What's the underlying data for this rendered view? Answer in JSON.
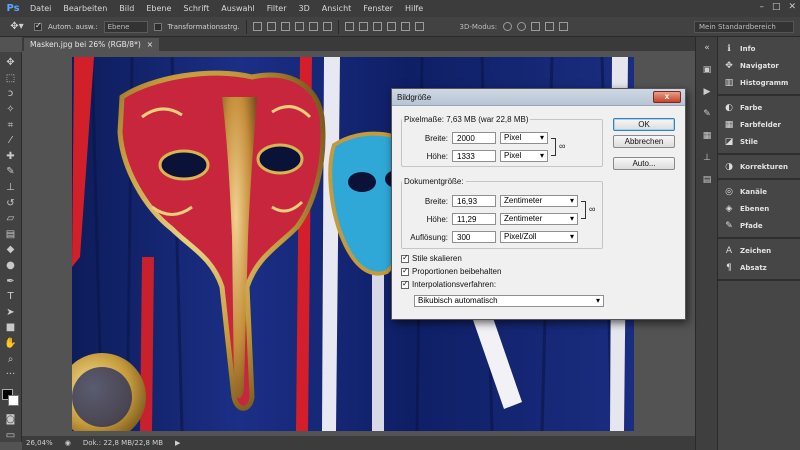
{
  "app": {
    "logo": "Ps"
  },
  "menu": [
    "Datei",
    "Bearbeiten",
    "Bild",
    "Ebene",
    "Schrift",
    "Auswahl",
    "Filter",
    "3D",
    "Ansicht",
    "Fenster",
    "Hilfe"
  ],
  "window_controls": {
    "minimize": "–",
    "maximize": "□",
    "close": "✕"
  },
  "options": {
    "auto_select_label": "Autom. ausw.:",
    "auto_select_value": "Ebene",
    "transform_label": "Transformationsstrg.",
    "mode_3d_label": "3D-Modus:",
    "workspace": "Mein Standardbereich"
  },
  "document_tab": {
    "title": "Masken.jpg bei 26% (RGB/8*)",
    "close": "×"
  },
  "status": {
    "zoom": "26,04%",
    "doc": "Dok.: 22,8 MB/22,8 MB"
  },
  "panels": [
    [
      {
        "icon": "info-icon",
        "glyph": "ℹ",
        "label": "Info"
      },
      {
        "icon": "navigator-icon",
        "glyph": "✥",
        "label": "Navigator"
      },
      {
        "icon": "histogram-icon",
        "glyph": "▥",
        "label": "Histogramm"
      }
    ],
    [
      {
        "icon": "color-icon",
        "glyph": "◐",
        "label": "Farbe"
      },
      {
        "icon": "swatches-icon",
        "glyph": "▦",
        "label": "Farbfelder"
      },
      {
        "icon": "styles-icon",
        "glyph": "◪",
        "label": "Stile"
      }
    ],
    [
      {
        "icon": "adjustments-icon",
        "glyph": "◑",
        "label": "Korrekturen"
      }
    ],
    [
      {
        "icon": "channels-icon",
        "glyph": "◎",
        "label": "Kanäle"
      },
      {
        "icon": "layers-icon",
        "glyph": "◈",
        "label": "Ebenen"
      },
      {
        "icon": "paths-icon",
        "glyph": "✎",
        "label": "Pfade"
      }
    ],
    [
      {
        "icon": "character-icon",
        "glyph": "A",
        "label": "Zeichen"
      },
      {
        "icon": "paragraph-icon",
        "glyph": "¶",
        "label": "Absatz"
      }
    ]
  ],
  "dialog": {
    "title": "Bildgröße",
    "close": "x",
    "pixel_section": {
      "legend": "Pixelmaße: 7,63 MB (war 22,8 MB)",
      "width_label": "Breite:",
      "width_value": "2000",
      "width_unit": "Pixel",
      "height_label": "Höhe:",
      "height_value": "1333",
      "height_unit": "Pixel"
    },
    "doc_section": {
      "legend": "Dokumentgröße:",
      "width_label": "Breite:",
      "width_value": "16,93",
      "width_unit": "Zentimeter",
      "height_label": "Höhe:",
      "height_value": "11,29",
      "height_unit": "Zentimeter",
      "res_label": "Auflösung:",
      "res_value": "300",
      "res_unit": "Pixel/Zoll"
    },
    "checkboxes": [
      "Stile skalieren",
      "Proportionen beibehalten",
      "Interpolationsverfahren:"
    ],
    "interpolation": "Bikubisch automatisch",
    "buttons": {
      "ok": "OK",
      "cancel": "Abbrechen",
      "auto": "Auto..."
    }
  }
}
